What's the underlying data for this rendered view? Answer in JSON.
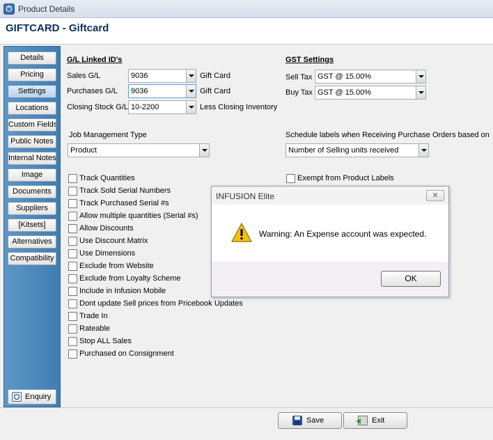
{
  "window": {
    "title": "Product Details",
    "app_icon": "power-icon"
  },
  "header": {
    "title": "GIFTCARD - Giftcard"
  },
  "sidebar": {
    "items": [
      {
        "label": "Details"
      },
      {
        "label": "Pricing"
      },
      {
        "label": "Settings",
        "active": true
      },
      {
        "label": "Locations"
      },
      {
        "label": "Custom Fields"
      },
      {
        "label": "Public Notes"
      },
      {
        "label": "Internal Notes"
      },
      {
        "label": "Image"
      },
      {
        "label": "Documents"
      },
      {
        "label": "Suppliers"
      },
      {
        "label": "[Kitsets]"
      },
      {
        "label": "Alternatives"
      },
      {
        "label": "Compatibility"
      }
    ],
    "enquiry_label": "Enquiry"
  },
  "gl": {
    "title": "G/L Linked ID's",
    "sales_label": "Sales G/L",
    "sales_value": "9036",
    "sales_desc": "Gift Card",
    "purchases_label": "Purchases G/L",
    "purchases_value": "9036",
    "purchases_desc": "Gift Card",
    "closing_label": "Closing Stock G/L",
    "closing_value": "10-2200",
    "closing_desc": "Less Closing Inventory"
  },
  "gst": {
    "title": "GST Settings",
    "sell_label": "Sell Tax",
    "sell_value": "GST @ 15.00%",
    "buy_label": "Buy Tax",
    "buy_value": "GST @ 15.00%"
  },
  "job": {
    "label": "Job Management Type",
    "value": "Product"
  },
  "schedule": {
    "label": "Schedule labels when Receiving Purchase Orders based on",
    "value": "Number of Selling units received"
  },
  "exempt_label": "Exempt from Product Labels",
  "checkboxes": [
    "Track Quantities",
    "Track Sold Serial Numbers",
    "Track Purchased Serial #s",
    "Allow multiple quantities (Serial #s)",
    "Allow Discounts",
    "Use Discount Matrix",
    "Use Dimensions",
    "Exclude from Website",
    "Exclude from Loyalty Scheme",
    "Include in Infusion Mobile",
    "Dont update Sell prices from Pricebook Updates",
    "Trade In",
    "Rateable",
    "Stop ALL Sales",
    "Purchased on Consignment"
  ],
  "footer": {
    "save_label": "Save",
    "exit_label": "Exit"
  },
  "dialog": {
    "title": "INFUSION Elite",
    "message": "Warning: An Expense account was expected.",
    "ok_label": "OK",
    "close_glyph": "✕",
    "warning_color": "#f4c20d"
  }
}
